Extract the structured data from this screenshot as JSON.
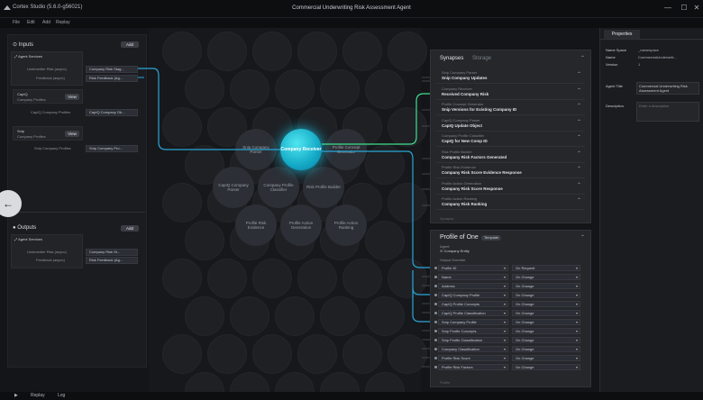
{
  "window": {
    "app_name": "Cortex Studio (5.6.0-g56021)",
    "title": "Commercial Underwriting Risk Assessment Agent",
    "minimize": "—",
    "maximize": "☐"
  },
  "menu": [
    "File",
    "Edit",
    "Add",
    "Replay"
  ],
  "inputs": {
    "title": "Inputs",
    "add": "Add",
    "service_title": "Agent Services",
    "service_rows": [
      {
        "label": "Underwriter Risk (async)",
        "value": "Company Risk Stag..."
      },
      {
        "label": "Feedback (async)",
        "value": "Risk Feedback (Ag..."
      }
    ],
    "card1": {
      "title": "CapIQ",
      "sub": "Company Profiles",
      "button": "View",
      "row_label": "CapIQ Company Profiles",
      "row_value": "CapIQ Company Ob..."
    },
    "card2": {
      "title": "Snip",
      "sub": "Company Profiles",
      "button": "View",
      "row_label": "Snip Company Profiles",
      "row_value": "Snip Company Pro..."
    }
  },
  "outputs": {
    "title": "Outputs",
    "add": "Add",
    "service_title": "Agent Services",
    "rows": [
      {
        "label": "Underwriter Risk (async)",
        "value": "Company Risk St..."
      },
      {
        "label": "Feedback (async)",
        "value": "Risk Feedback (Ag..."
      }
    ]
  },
  "canvas": {
    "center": "Company Receiver",
    "nodes": [
      "Snip Company Parser",
      "Profile Concept Generator",
      "CapIQ Company Parser",
      "Company Profile Classifier",
      "Risk Profile Builder",
      "Profile Risk Evidence",
      "Profile Action Generation",
      "Profile Action Ranking"
    ]
  },
  "synapses": {
    "tab_active": "Synapses",
    "tab_inactive": "Storage",
    "rows": [
      {
        "a": "Snip Company Parser",
        "b": "Snip Company Updates"
      },
      {
        "a": "Company Receiver",
        "b": "Received Company Risk"
      },
      {
        "a": "Profile Concept Generator",
        "b": "Snip Versions for Existing Company ID"
      },
      {
        "a": "CapIQ Company Parser",
        "b": "CapIQ Update Object"
      },
      {
        "a": "Company Profile Classifier",
        "b": "CapIQ for New Comp ID"
      },
      {
        "a": "Risk Profile Builder",
        "b": "Company Risk Factors Generated"
      },
      {
        "a": "Profile Risk Evidence",
        "b": "Company Risk Score Evidence Response"
      },
      {
        "a": "Profile Action Generation",
        "b": "Company Risk Score Response"
      },
      {
        "a": "Profile Action Ranking",
        "b": "Company Risk Ranking"
      }
    ],
    "footer": "Synapse"
  },
  "profile": {
    "title": "Profile of One",
    "badge": "Template",
    "agent_label": "Agent",
    "agent_value": "Company Entity",
    "output_label": "Output Override",
    "rows": [
      {
        "l": "Profile ID",
        "r": "On Request"
      },
      {
        "l": "Name",
        "r": "On Change"
      },
      {
        "l": "Address",
        "r": "On Change"
      },
      {
        "l": "CapIQ Company Profile",
        "r": "On Change"
      },
      {
        "l": "CapIQ Profile Concepts",
        "r": "On Change"
      },
      {
        "l": "CapIQ Profile Classification",
        "r": "On Change"
      },
      {
        "l": "Snip Company Profile",
        "r": "On Change"
      },
      {
        "l": "Snip Profile Concepts",
        "r": "On Change"
      },
      {
        "l": "Snip Profile Classification",
        "r": "On Change"
      },
      {
        "l": "Company Classification",
        "r": "On Change"
      },
      {
        "l": "Profile Risk Score",
        "r": "On Change"
      },
      {
        "l": "Profile Risk Factors",
        "r": "On Change"
      }
    ],
    "footer": "Profile"
  },
  "properties": {
    "tab": "Properties",
    "rows": [
      {
        "label": "Name Space",
        "value": "_namespace"
      },
      {
        "label": "Name",
        "value": "CommercialUnderwriti..."
      },
      {
        "label": "Version",
        "value": "1"
      }
    ],
    "agent_title_label": "Agent Title",
    "agent_title_value": "Commercial Underwriting Risk Assessment Agent",
    "description_label": "Description",
    "description_placeholder": "Enter a description"
  },
  "statusbar": {
    "play": "▶",
    "replay": "Replay",
    "log": "Log"
  },
  "colors": {
    "accent": "#1ab8d6",
    "link_green": "#3ee08e",
    "link_blue": "#2aa6d8"
  }
}
